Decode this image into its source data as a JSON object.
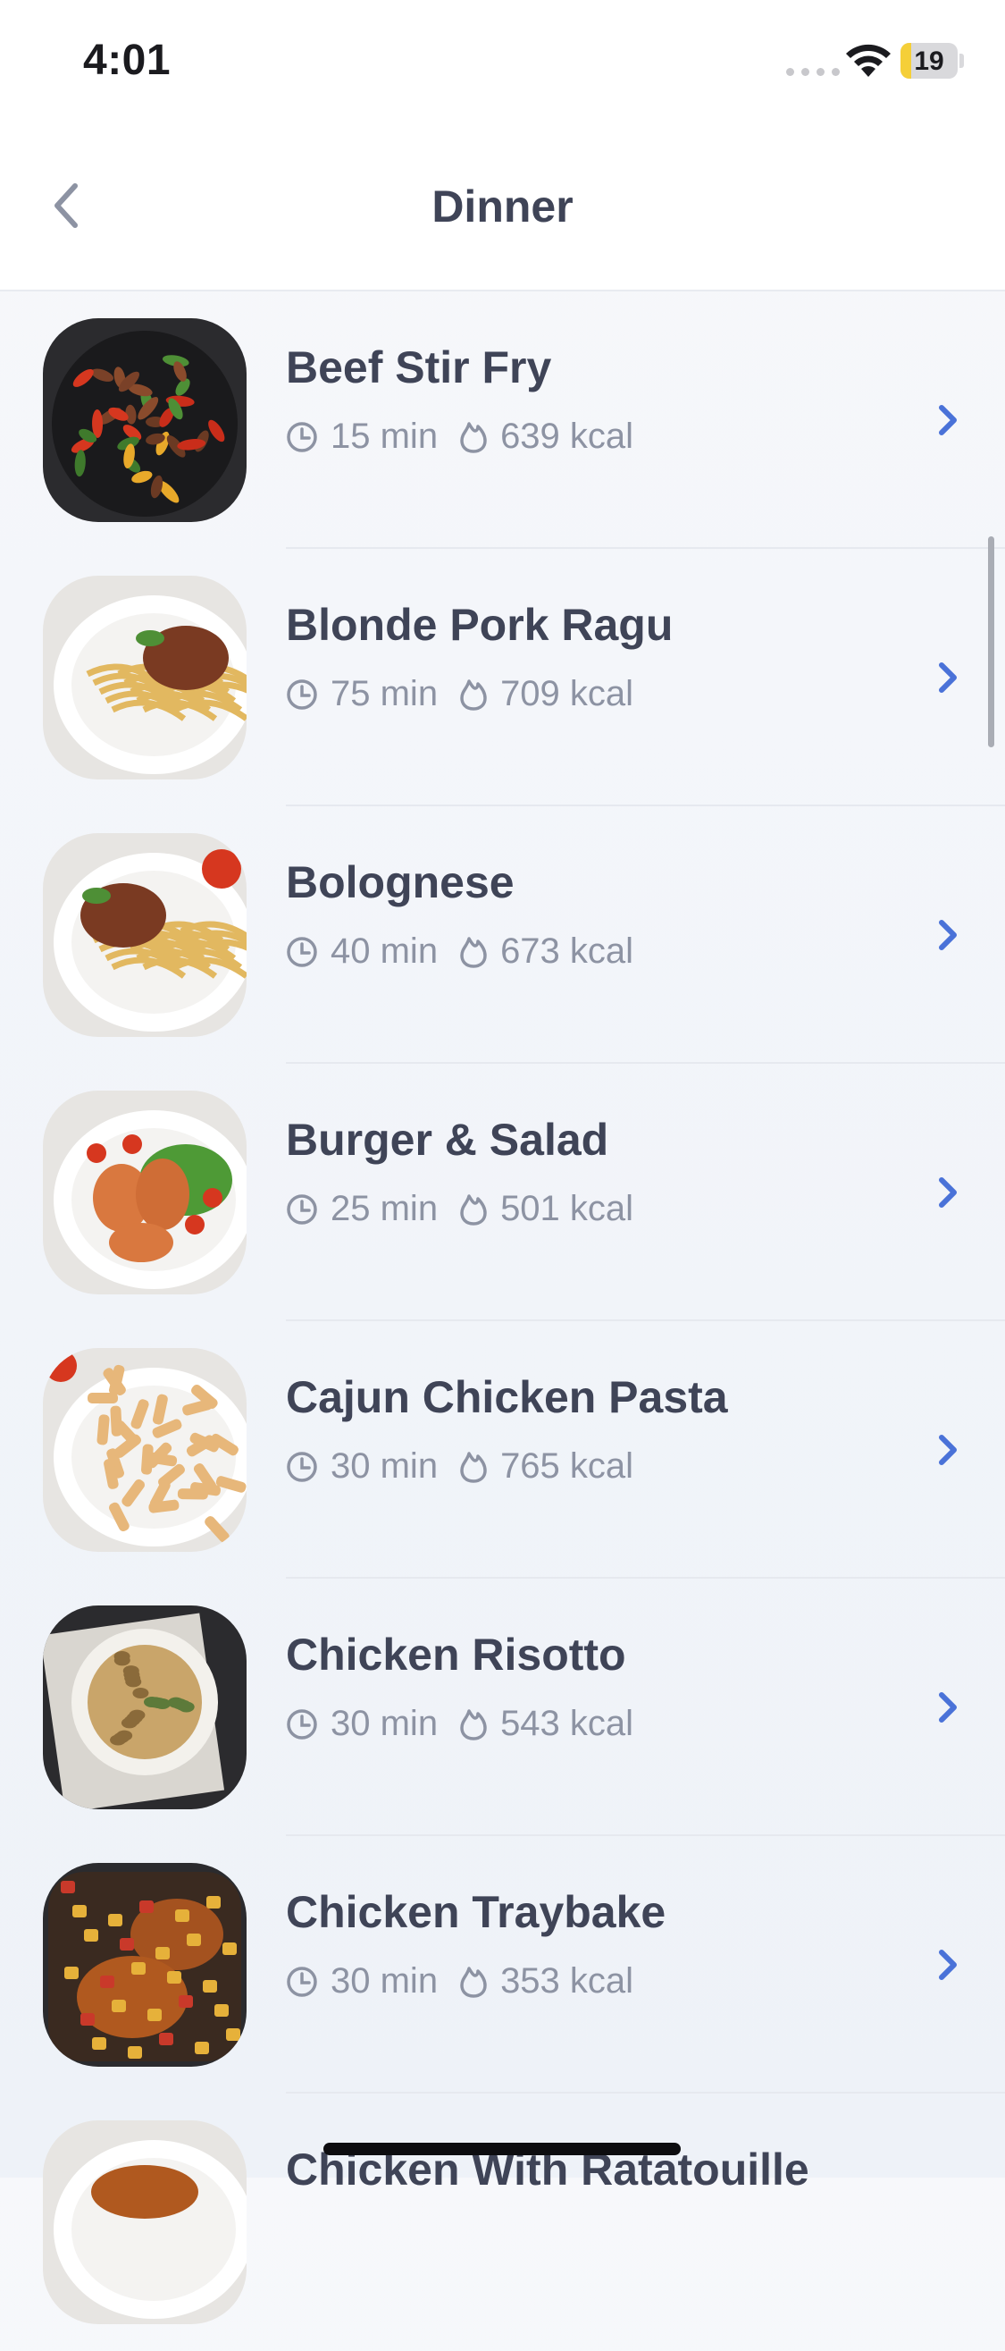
{
  "status_bar": {
    "time": "4:01",
    "battery_level": "19",
    "battery_fraction": 0.19,
    "colors": {
      "battery_fill": "#f5cf38"
    }
  },
  "nav": {
    "title": "Dinner",
    "back_icon": "chevron-left-icon"
  },
  "recipes": [
    {
      "name": "Beef Stir Fry",
      "time": "15 min",
      "kcal": "639 kcal",
      "image": "dark-plate-stir-fry"
    },
    {
      "name": "Blonde Pork Ragu",
      "time": "75 min",
      "kcal": "709 kcal",
      "image": "white-plate-ragu"
    },
    {
      "name": "Bolognese",
      "time": "40 min",
      "kcal": "673 kcal",
      "image": "white-plate-bolognese"
    },
    {
      "name": "Burger & Salad",
      "time": "25 min",
      "kcal": "501 kcal",
      "image": "white-plate-patties"
    },
    {
      "name": "Cajun Chicken Pasta",
      "time": "30 min",
      "kcal": "765 kcal",
      "image": "white-plate-penne"
    },
    {
      "name": "Chicken Risotto",
      "time": "30 min",
      "kcal": "543 kcal",
      "image": "dark-bowl-risotto"
    },
    {
      "name": "Chicken Traybake",
      "time": "30 min",
      "kcal": "353 kcal",
      "image": "dark-tray-chicken"
    },
    {
      "name": "Chicken With Ratatouille",
      "time": "",
      "kcal": "",
      "image": "white-plate-partial"
    }
  ],
  "icons": {
    "time": "clock-icon",
    "kcal": "flame-icon",
    "row_action": "chevron-right-icon"
  },
  "colors": {
    "accent": "#4a72d8",
    "title_text": "#3f4457",
    "meta_text": "#8d93a3"
  }
}
